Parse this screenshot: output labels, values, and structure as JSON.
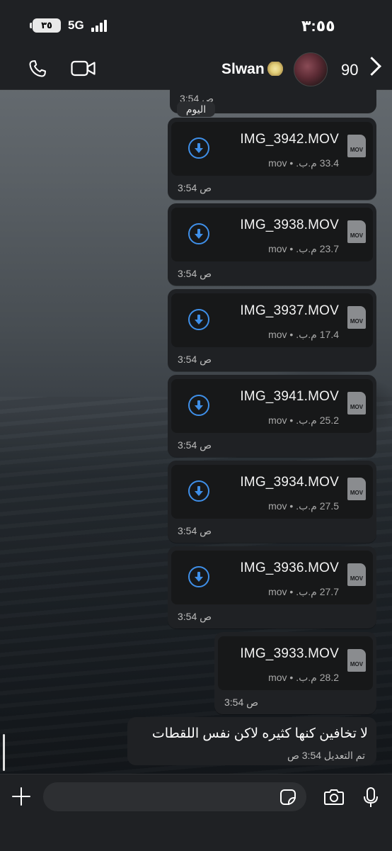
{
  "status_bar": {
    "time": "٣:٥٥",
    "battery": "٣٥",
    "network": "5G"
  },
  "header": {
    "back_count": "90",
    "contact_name": "Slwan",
    "contact_emoji": "flower-emoji",
    "icons": [
      "chevron-back-icon",
      "video-call-icon",
      "voice-call-icon"
    ]
  },
  "chat": {
    "top_time": "3:54 ص",
    "date_chip": "اليوم",
    "files": [
      {
        "name": "IMG_3942.MOV",
        "meta": "33.4 م.ب. • mov",
        "time": "3:54 ص",
        "downloadable": true
      },
      {
        "name": "IMG_3938.MOV",
        "meta": "23.7 م.ب. • mov",
        "time": "3:54 ص",
        "downloadable": true
      },
      {
        "name": "IMG_3937.MOV",
        "meta": "17.4 م.ب. • mov",
        "time": "3:54 ص",
        "downloadable": true
      },
      {
        "name": "IMG_3941.MOV",
        "meta": "25.2 م.ب. • mov",
        "time": "3:54 ص",
        "downloadable": true
      },
      {
        "name": "IMG_3934.MOV",
        "meta": "27.5 م.ب. • mov",
        "time": "3:54 ص",
        "downloadable": true
      },
      {
        "name": "IMG_3936.MOV",
        "meta": "27.7 م.ب. • mov",
        "time": "3:54 ص",
        "downloadable": true
      },
      {
        "name": "IMG_3933.MOV",
        "meta": "28.2 م.ب. • mov",
        "time": "3:54 ص",
        "downloadable": false
      }
    ],
    "doc_icon_label": "MOV",
    "text_message": {
      "body": "لا تخافين كنها كثيره لاكن نفس اللقطات",
      "edited": "تم التعديل 3:54 ص"
    }
  },
  "composer": {
    "placeholder": "",
    "icons": [
      "plus-icon",
      "sticker-icon",
      "camera-icon",
      "microphone-icon"
    ]
  },
  "colors": {
    "accent": "#3f8fe8",
    "bubble": "#1f2124",
    "file_card": "#171819"
  }
}
